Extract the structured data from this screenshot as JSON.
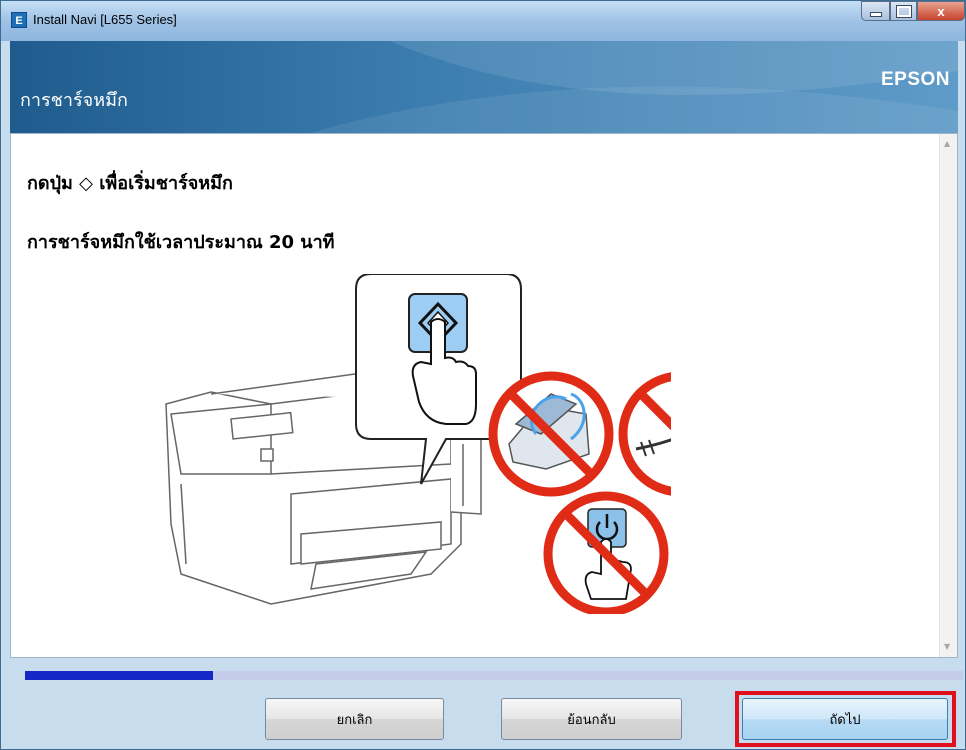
{
  "window": {
    "title": "Install Navi [L655 Series]",
    "app_icon_letter": "E",
    "close_glyph": "x"
  },
  "header": {
    "title": "การชาร์จหมึก",
    "brand": "EPSON"
  },
  "content": {
    "instruction_1": "กดปุ่ม ◇ เพื่อเริ่มชาร์จหมึก",
    "instruction_2": "การชาร์จหมึกใช้เวลาประมาณ 20 นาที"
  },
  "progress": {
    "fraction": 0.2
  },
  "buttons": {
    "cancel": "ยกเลิก",
    "back": "ย้อนกลับ",
    "next": "ถัดไป"
  },
  "colors": {
    "header_bg": "#2e6f9f",
    "progress_fill": "#1428c8",
    "progress_track": "#c5cbeb",
    "prohibition_red": "#e02b17",
    "highlight_border": "#e0101e",
    "button_blue": "#6aaee8"
  },
  "icons": [
    "app-icon",
    "minimize-icon",
    "maximize-icon",
    "close-icon",
    "start-button-icon",
    "power-icon",
    "prohibited-sign-icon"
  ]
}
